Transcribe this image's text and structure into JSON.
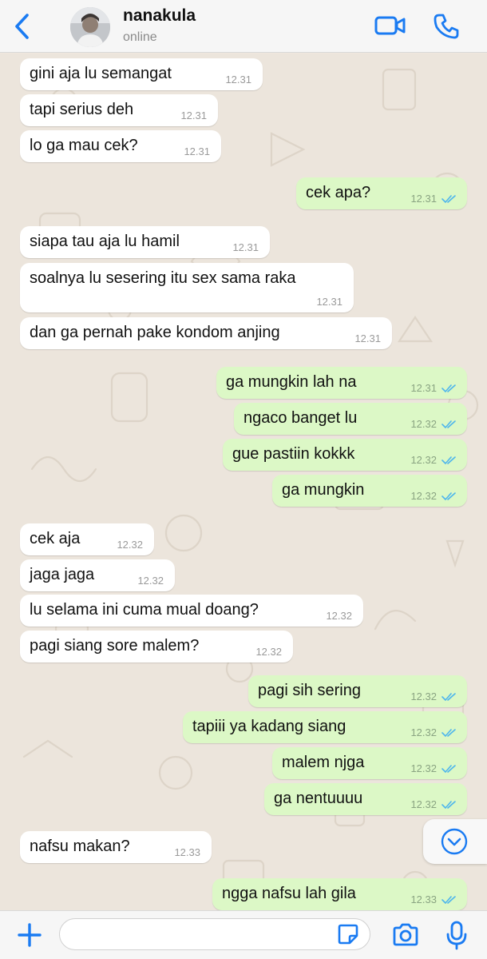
{
  "header": {
    "contact_name": "nanakula",
    "status": "online",
    "accent_color": "#1a7bf2"
  },
  "messages": [
    {
      "direction": "in",
      "text": "gini aja lu semangat",
      "time": "12.31"
    },
    {
      "direction": "in",
      "text": "tapi serius deh",
      "time": "12.31"
    },
    {
      "direction": "in",
      "text": "lo ga mau cek?",
      "time": "12.31"
    },
    {
      "direction": "out",
      "text": "cek apa?",
      "time": "12.31",
      "read": true
    },
    {
      "direction": "in",
      "text": "siapa tau aja lu hamil",
      "time": "12.31"
    },
    {
      "direction": "in",
      "text": "soalnya lu sesering itu sex sama raka",
      "time": "12.31"
    },
    {
      "direction": "in",
      "text": "dan ga pernah pake kondom anjing",
      "time": "12.31"
    },
    {
      "direction": "out",
      "text": "ga mungkin lah na",
      "time": "12.31",
      "read": true
    },
    {
      "direction": "out",
      "text": "ngaco banget lu",
      "time": "12.32",
      "read": true
    },
    {
      "direction": "out",
      "text": "gue pastiin kokkk",
      "time": "12.32",
      "read": true
    },
    {
      "direction": "out",
      "text": "ga mungkin",
      "time": "12.32",
      "read": true
    },
    {
      "direction": "in",
      "text": "cek aja",
      "time": "12.32"
    },
    {
      "direction": "in",
      "text": "jaga jaga",
      "time": "12.32"
    },
    {
      "direction": "in",
      "text": "lu selama ini cuma mual doang?",
      "time": "12.32"
    },
    {
      "direction": "in",
      "text": "pagi siang sore malem?",
      "time": "12.32"
    },
    {
      "direction": "out",
      "text": "pagi sih sering",
      "time": "12.32",
      "read": true
    },
    {
      "direction": "out",
      "text": "tapiii ya kadang siang",
      "time": "12.32",
      "read": true
    },
    {
      "direction": "out",
      "text": "malem njga",
      "time": "12.32",
      "read": true
    },
    {
      "direction": "out",
      "text": "ga nentuuuu",
      "time": "12.32",
      "read": true
    },
    {
      "direction": "in",
      "text": "nafsu makan?",
      "time": "12.33"
    },
    {
      "direction": "out",
      "text": "ngga nafsu lah gila",
      "time": "12.33",
      "read": true
    }
  ],
  "input": {
    "placeholder": "",
    "value": ""
  },
  "colors": {
    "incoming_bubble": "#ffffff",
    "outgoing_bubble": "#dcf8c6",
    "read_ticks": "#4fb6ec",
    "wallpaper": "#ece5dc"
  },
  "icons": {
    "back": "chevron-left-icon",
    "video": "video-camera-icon",
    "call": "phone-icon",
    "scroll": "chevron-down-circle-icon",
    "plus": "plus-icon",
    "sticker": "sticker-icon",
    "camera": "camera-icon",
    "mic": "microphone-icon"
  }
}
